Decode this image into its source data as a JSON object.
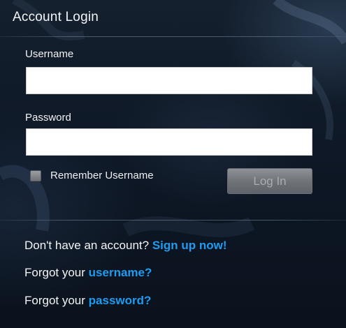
{
  "dialog": {
    "title": "Account Login"
  },
  "form": {
    "username_label": "Username",
    "username_value": "",
    "password_label": "Password",
    "password_value": "",
    "remember_label": "Remember Username",
    "remember_checked": false,
    "login_label": "Log In",
    "login_enabled": false
  },
  "help": {
    "signup_prefix": "Don't have an account?",
    "signup_link": "Sign up now!",
    "forgot_username_prefix": "Forgot your",
    "forgot_username_link": "username?",
    "forgot_password_prefix": "Forgot your",
    "forgot_password_link": "password?"
  },
  "colors": {
    "link": "#1f9bf0",
    "background": "#0c1521"
  }
}
